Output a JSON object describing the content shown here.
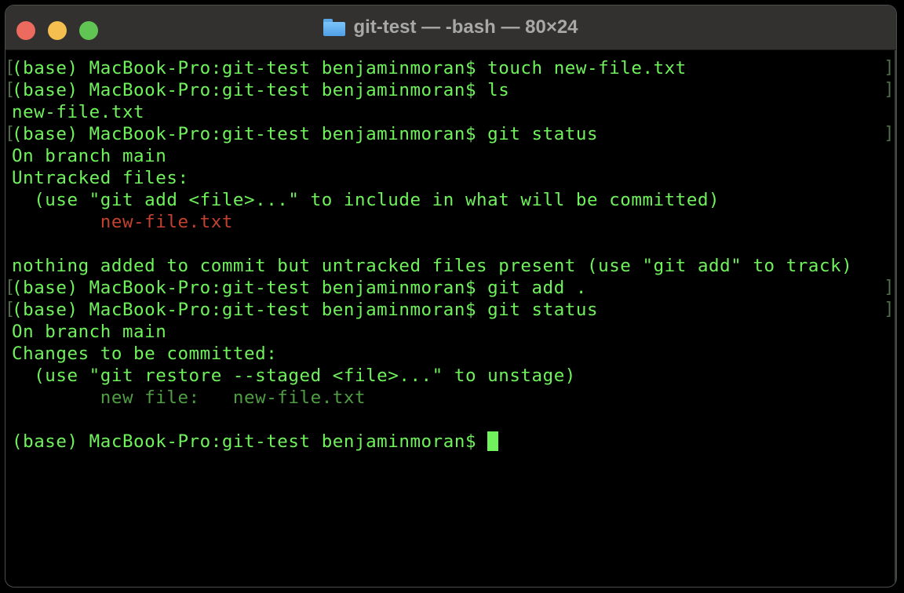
{
  "window": {
    "title": "git-test — -bash — 80×24",
    "folder_icon": "folder-icon",
    "traffic_lights": [
      "close",
      "minimize",
      "maximize"
    ]
  },
  "colors": {
    "text": "#6ff25b",
    "untracked": "#c4412f",
    "staged": "#4f9e43",
    "background": "#000000",
    "titlebar": "#323130"
  },
  "terminal": {
    "prompt": "(base) MacBook-Pro:git-test benjaminmoran$",
    "lines": [
      {
        "text": "(base) MacBook-Pro:git-test benjaminmoran$ touch new-file.txt",
        "marked": true
      },
      {
        "text": "(base) MacBook-Pro:git-test benjaminmoran$ ls",
        "marked": true
      },
      {
        "text": "new-file.txt",
        "marked": false
      },
      {
        "text": "(base) MacBook-Pro:git-test benjaminmoran$ git status",
        "marked": true
      },
      {
        "text": "On branch main",
        "marked": false
      },
      {
        "text": "Untracked files:",
        "marked": false
      },
      {
        "text": "  (use \"git add <file>...\" to include in what will be committed)",
        "marked": false
      },
      {
        "text": "        new-file.txt",
        "marked": false,
        "style": "red"
      },
      {
        "text": "",
        "marked": false
      },
      {
        "text": "nothing added to commit but untracked files present (use \"git add\" to track)",
        "marked": false
      },
      {
        "text": "(base) MacBook-Pro:git-test benjaminmoran$ git add .",
        "marked": true
      },
      {
        "text": "(base) MacBook-Pro:git-test benjaminmoran$ git status",
        "marked": true
      },
      {
        "text": "On branch main",
        "marked": false
      },
      {
        "text": "Changes to be committed:",
        "marked": false
      },
      {
        "text": "  (use \"git restore --staged <file>...\" to unstage)",
        "marked": false
      },
      {
        "text": "        new file:   new-file.txt",
        "marked": false,
        "style": "dim"
      },
      {
        "text": "",
        "marked": false
      },
      {
        "text": "(base) MacBook-Pro:git-test benjaminmoran$ ",
        "marked": false,
        "cursor": true
      }
    ]
  }
}
